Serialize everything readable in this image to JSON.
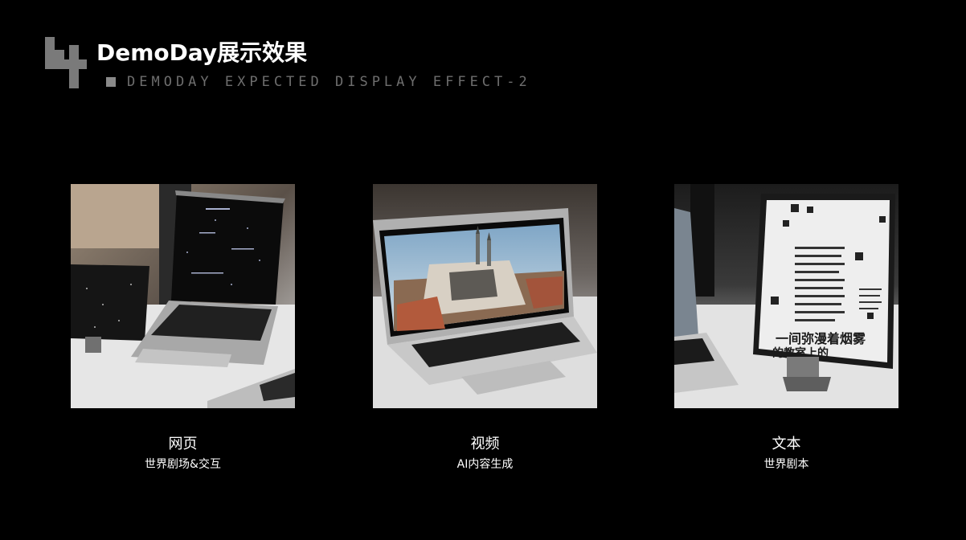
{
  "header": {
    "section_number": "4",
    "title": "DemoDay展示效果",
    "subtitle": "DEMODAY EXPECTED DISPLAY EFFECT-2"
  },
  "cards": [
    {
      "label": "网页",
      "description": "世界剧场&交互",
      "photo": "laptop-and-tablet-showing-web-page"
    },
    {
      "label": "视频",
      "description": "AI内容生成",
      "photo": "laptop-showing-aerial-town-video"
    },
    {
      "label": "文本",
      "description": "世界剧本",
      "photo": "tablet-showing-chinese-text",
      "screen_text": {
        "headline_1": "一间弥漫着烟雾",
        "headline_2": "的教室上的"
      }
    }
  ],
  "colors": {
    "background": "#000000",
    "text": "#ffffff",
    "subtitle": "#6e6e6e",
    "number": "#7a7a7a"
  }
}
